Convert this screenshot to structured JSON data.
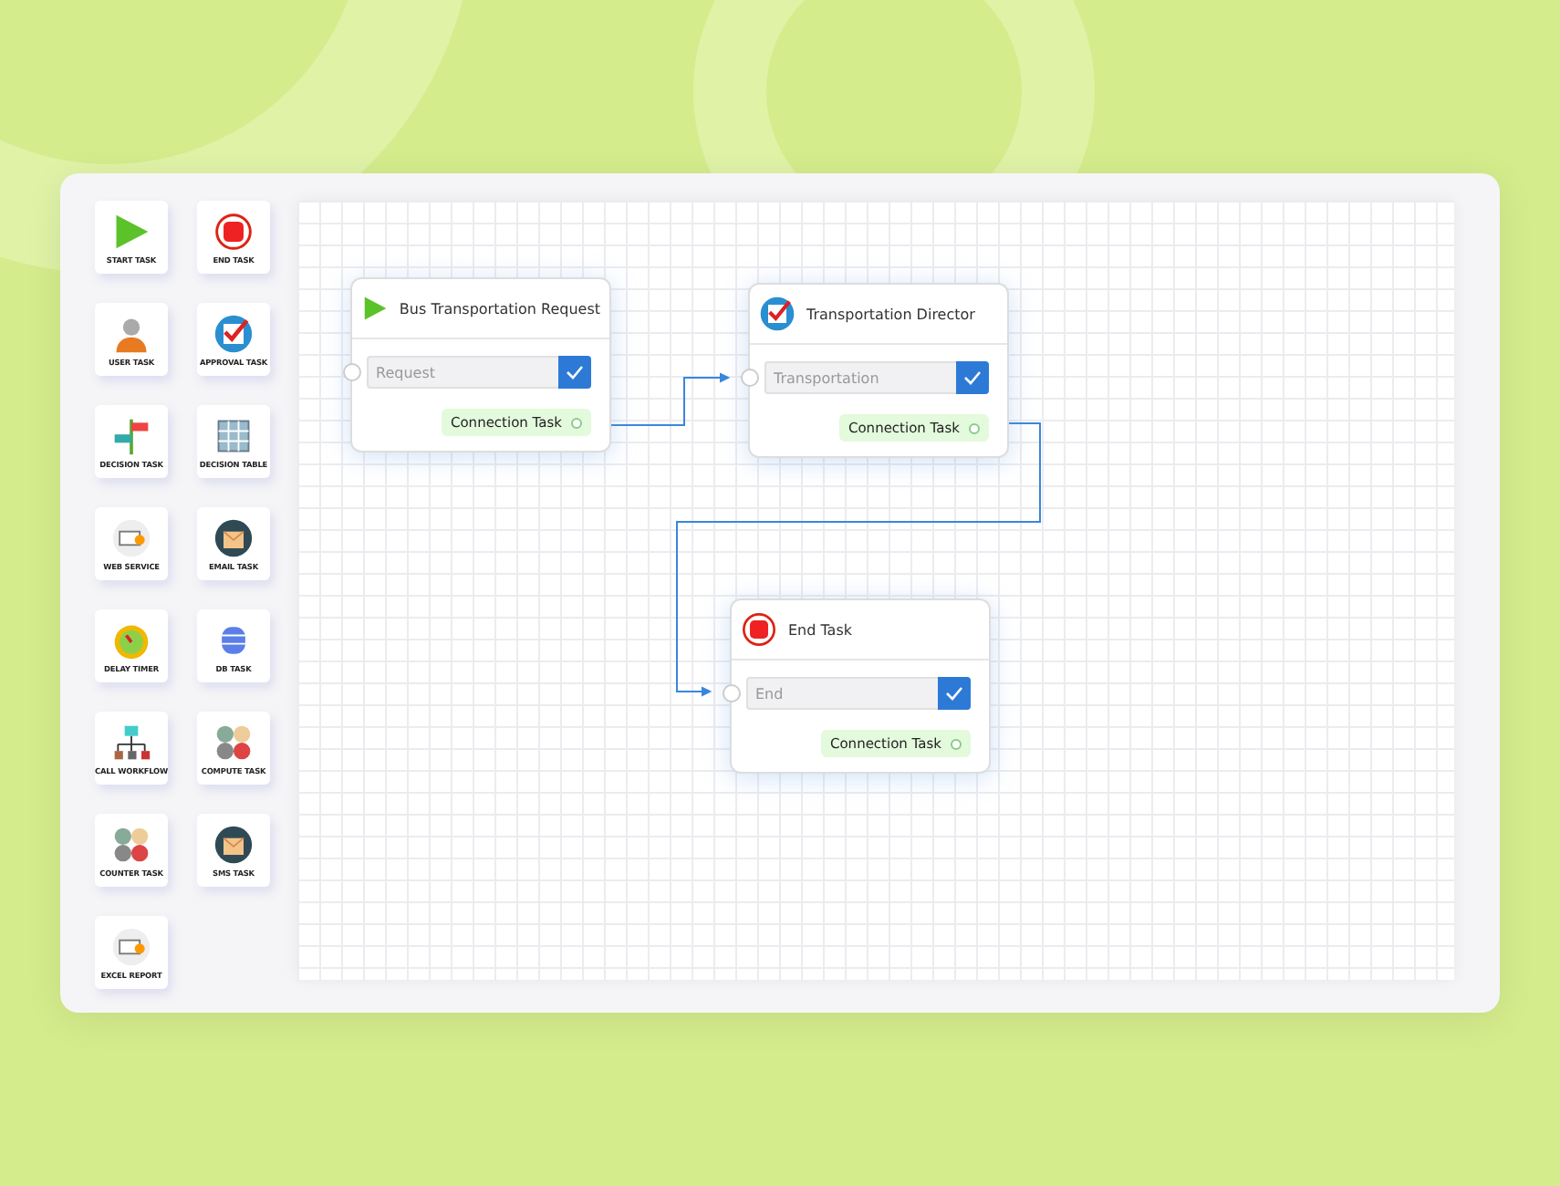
{
  "palette": [
    {
      "label": "START TASK",
      "kind": "start"
    },
    {
      "label": "END TASK",
      "kind": "end"
    },
    {
      "label": "USER TASK",
      "kind": "user"
    },
    {
      "label": "APPROVAL TASK",
      "kind": "approval"
    },
    {
      "label": "DECISION TASK",
      "kind": "decision"
    },
    {
      "label": "DECISION TABLE",
      "kind": "table"
    },
    {
      "label": "WEB SERVICE",
      "kind": "web"
    },
    {
      "label": "EMAIL TASK",
      "kind": "mail"
    },
    {
      "label": "DELAY TIMER",
      "kind": "timer"
    },
    {
      "label": "DB TASK",
      "kind": "db"
    },
    {
      "label": "CALL WORKFLOW",
      "kind": "workflow"
    },
    {
      "label": "COMPUTE TASK",
      "kind": "compute"
    },
    {
      "label": "COUNTER TASK",
      "kind": "compute"
    },
    {
      "label": "SMS TASK",
      "kind": "mail"
    },
    {
      "label": "EXCEL REPORT",
      "kind": "web"
    }
  ],
  "nodes": [
    {
      "title": "Bus Transportation Request",
      "kind": "start",
      "placeholder": "Request",
      "connection": "Connection Task"
    },
    {
      "title": "Transportation Director",
      "kind": "approval",
      "placeholder": "Transportation",
      "connection": "Connection Task"
    },
    {
      "title": "End Task",
      "kind": "end",
      "placeholder": "End",
      "connection": "Connection Task"
    }
  ]
}
